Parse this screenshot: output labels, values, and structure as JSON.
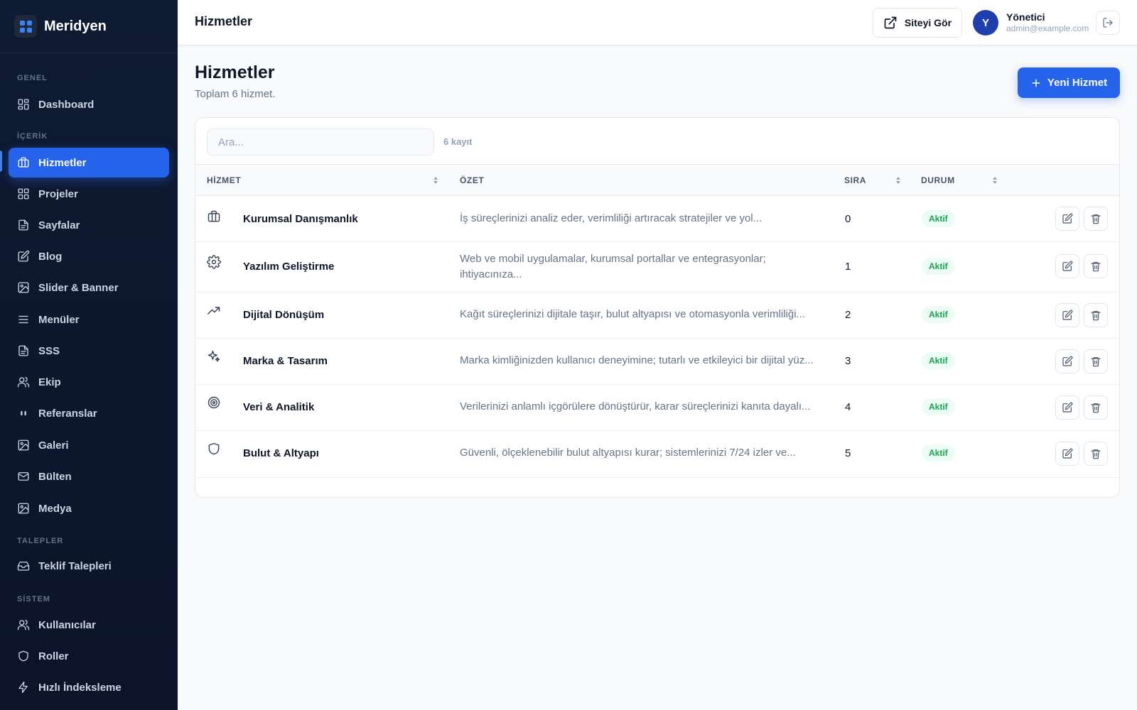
{
  "brand": {
    "name": "Meridyen",
    "logo_icon": "grid-logo-icon"
  },
  "sidebar": {
    "sections": [
      {
        "label": "GENEL",
        "items": [
          {
            "label": "Dashboard",
            "icon": "dashboard-icon"
          }
        ]
      },
      {
        "label": "İÇERİK",
        "items": [
          {
            "label": "Hizmetler",
            "icon": "briefcase-icon",
            "active": true
          },
          {
            "label": "Projeler",
            "icon": "grid-icon"
          },
          {
            "label": "Sayfalar",
            "icon": "file-icon"
          },
          {
            "label": "Blog",
            "icon": "edit-icon"
          },
          {
            "label": "Slider & Banner",
            "icon": "image-icon"
          },
          {
            "label": "Menüler",
            "icon": "menu-icon"
          },
          {
            "label": "SSS",
            "icon": "file-icon"
          },
          {
            "label": "Ekip",
            "icon": "users-icon"
          },
          {
            "label": "Referanslar",
            "icon": "quote-icon"
          },
          {
            "label": "Galeri",
            "icon": "image-icon"
          },
          {
            "label": "Bülten",
            "icon": "mail-icon"
          },
          {
            "label": "Medya",
            "icon": "image-icon"
          }
        ]
      },
      {
        "label": "TALEPLER",
        "items": [
          {
            "label": "Teklif Talepleri",
            "icon": "inbox-icon"
          }
        ]
      },
      {
        "label": "SİSTEM",
        "items": [
          {
            "label": "Kullanıcılar",
            "icon": "users-icon"
          },
          {
            "label": "Roller",
            "icon": "shield-icon"
          },
          {
            "label": "Hızlı İndeksleme",
            "icon": "bolt-icon"
          }
        ]
      }
    ]
  },
  "topbar": {
    "title": "Hizmetler",
    "view_site": "Siteyi Gör",
    "user": {
      "initial": "Y",
      "name": "Yönetici",
      "email": "admin@example.com"
    }
  },
  "page": {
    "title": "Hizmetler",
    "subtitle": "Toplam 6 hizmet.",
    "new_button": "Yeni Hizmet"
  },
  "table": {
    "search_placeholder": "Ara...",
    "count_label": "6 kayıt",
    "columns": {
      "service": "HİZMET",
      "summary": "ÖZET",
      "order": "SIRA",
      "status": "DURUM"
    },
    "rows": [
      {
        "icon": "briefcase-icon",
        "name": "Kurumsal Danışmanlık",
        "summary": "İş süreçlerinizi analiz eder, verimliliği artıracak stratejiler ve yol...",
        "order": "0",
        "status": "Aktif"
      },
      {
        "icon": "gear-icon",
        "name": "Yazılım Geliştirme",
        "summary": "Web ve mobil uygulamalar, kurumsal portallar ve entegrasyonlar; ihtiyacınıza...",
        "order": "1",
        "status": "Aktif"
      },
      {
        "icon": "trending-up-icon",
        "name": "Dijital Dönüşüm",
        "summary": "Kağıt süreçlerinizi dijitale taşır, bulut altyapısı ve otomasyonla verimliliği...",
        "order": "2",
        "status": "Aktif"
      },
      {
        "icon": "sparkles-icon",
        "name": "Marka & Tasarım",
        "summary": "Marka kimliğinizden kullanıcı deneyimine; tutarlı ve etkileyici bir dijital yüz...",
        "order": "3",
        "status": "Aktif"
      },
      {
        "icon": "target-icon",
        "name": "Veri & Analitik",
        "summary": "Verilerinizi anlamlı içgörülere dönüştürür, karar süreçlerinizi kanıta dayalı...",
        "order": "4",
        "status": "Aktif"
      },
      {
        "icon": "shield-icon",
        "name": "Bulut & Altyapı",
        "summary": "Güvenli, ölçeklenebilir bulut altyapısı kurar; sistemlerinizi 7/24 izler ve...",
        "order": "5",
        "status": "Aktif"
      }
    ]
  },
  "colors": {
    "accent": "#2563eb",
    "sidebar_bg": "#0f1b33",
    "status_active": "#16a34a"
  }
}
